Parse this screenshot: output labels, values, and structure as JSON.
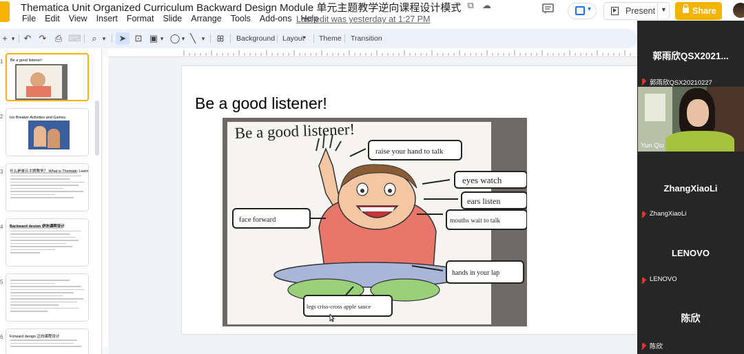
{
  "app": {
    "doc_title": "Thematica Unit Organized Curriculum Backward Design Module 单元主题教学逆向课程设计模式",
    "menu": [
      "File",
      "Edit",
      "View",
      "Insert",
      "Format",
      "Slide",
      "Arrange",
      "Tools",
      "Add-ons",
      "Help"
    ],
    "last_edit": "Last edit was yesterday at 1:27 PM",
    "present_label": "Present",
    "share_label": "Share",
    "brand_color": "#f4b400"
  },
  "toolbar": {
    "background_label": "Background",
    "layout_label": "Layout",
    "theme_label": "Theme",
    "transition_label": "Transition"
  },
  "filmstrip": {
    "slides": [
      {
        "title": "Be a good listener!",
        "active": true
      },
      {
        "title": "Ice Breaker Activities and Games",
        "active": false
      },
      {
        "title": "什么是单元主题教学？ What is Thematic Learning?",
        "active": false
      },
      {
        "title": "Backward design 逆向课程设计",
        "active": false
      },
      {
        "title": "",
        "active": false
      },
      {
        "title": "Forward design 正向课程设计",
        "active": false
      }
    ]
  },
  "slide": {
    "title": "Be a good listener!",
    "poster": {
      "heading": "Be a good listener!",
      "labels": [
        "raise your hand to talk",
        "eyes watch",
        "ears listen",
        "face forward",
        "mouths wait to talk",
        "hands in your lap",
        "legs criss-cross apple sauce"
      ]
    }
  },
  "participants": [
    {
      "big_name": "郭雨欣QSX2021...",
      "label": "郭雨欣QSX20210227",
      "muted": true,
      "video": false
    },
    {
      "big_name": "",
      "label": "Yun Qiu",
      "muted": false,
      "video": true
    },
    {
      "big_name": "ZhangXiaoLi",
      "label": "ZhangXiaoLi",
      "muted": true,
      "video": false
    },
    {
      "big_name": "LENOVO",
      "label": "LENOVO",
      "muted": true,
      "video": false
    },
    {
      "big_name": "陈欣",
      "label": "陈欣",
      "muted": true,
      "video": false
    }
  ]
}
